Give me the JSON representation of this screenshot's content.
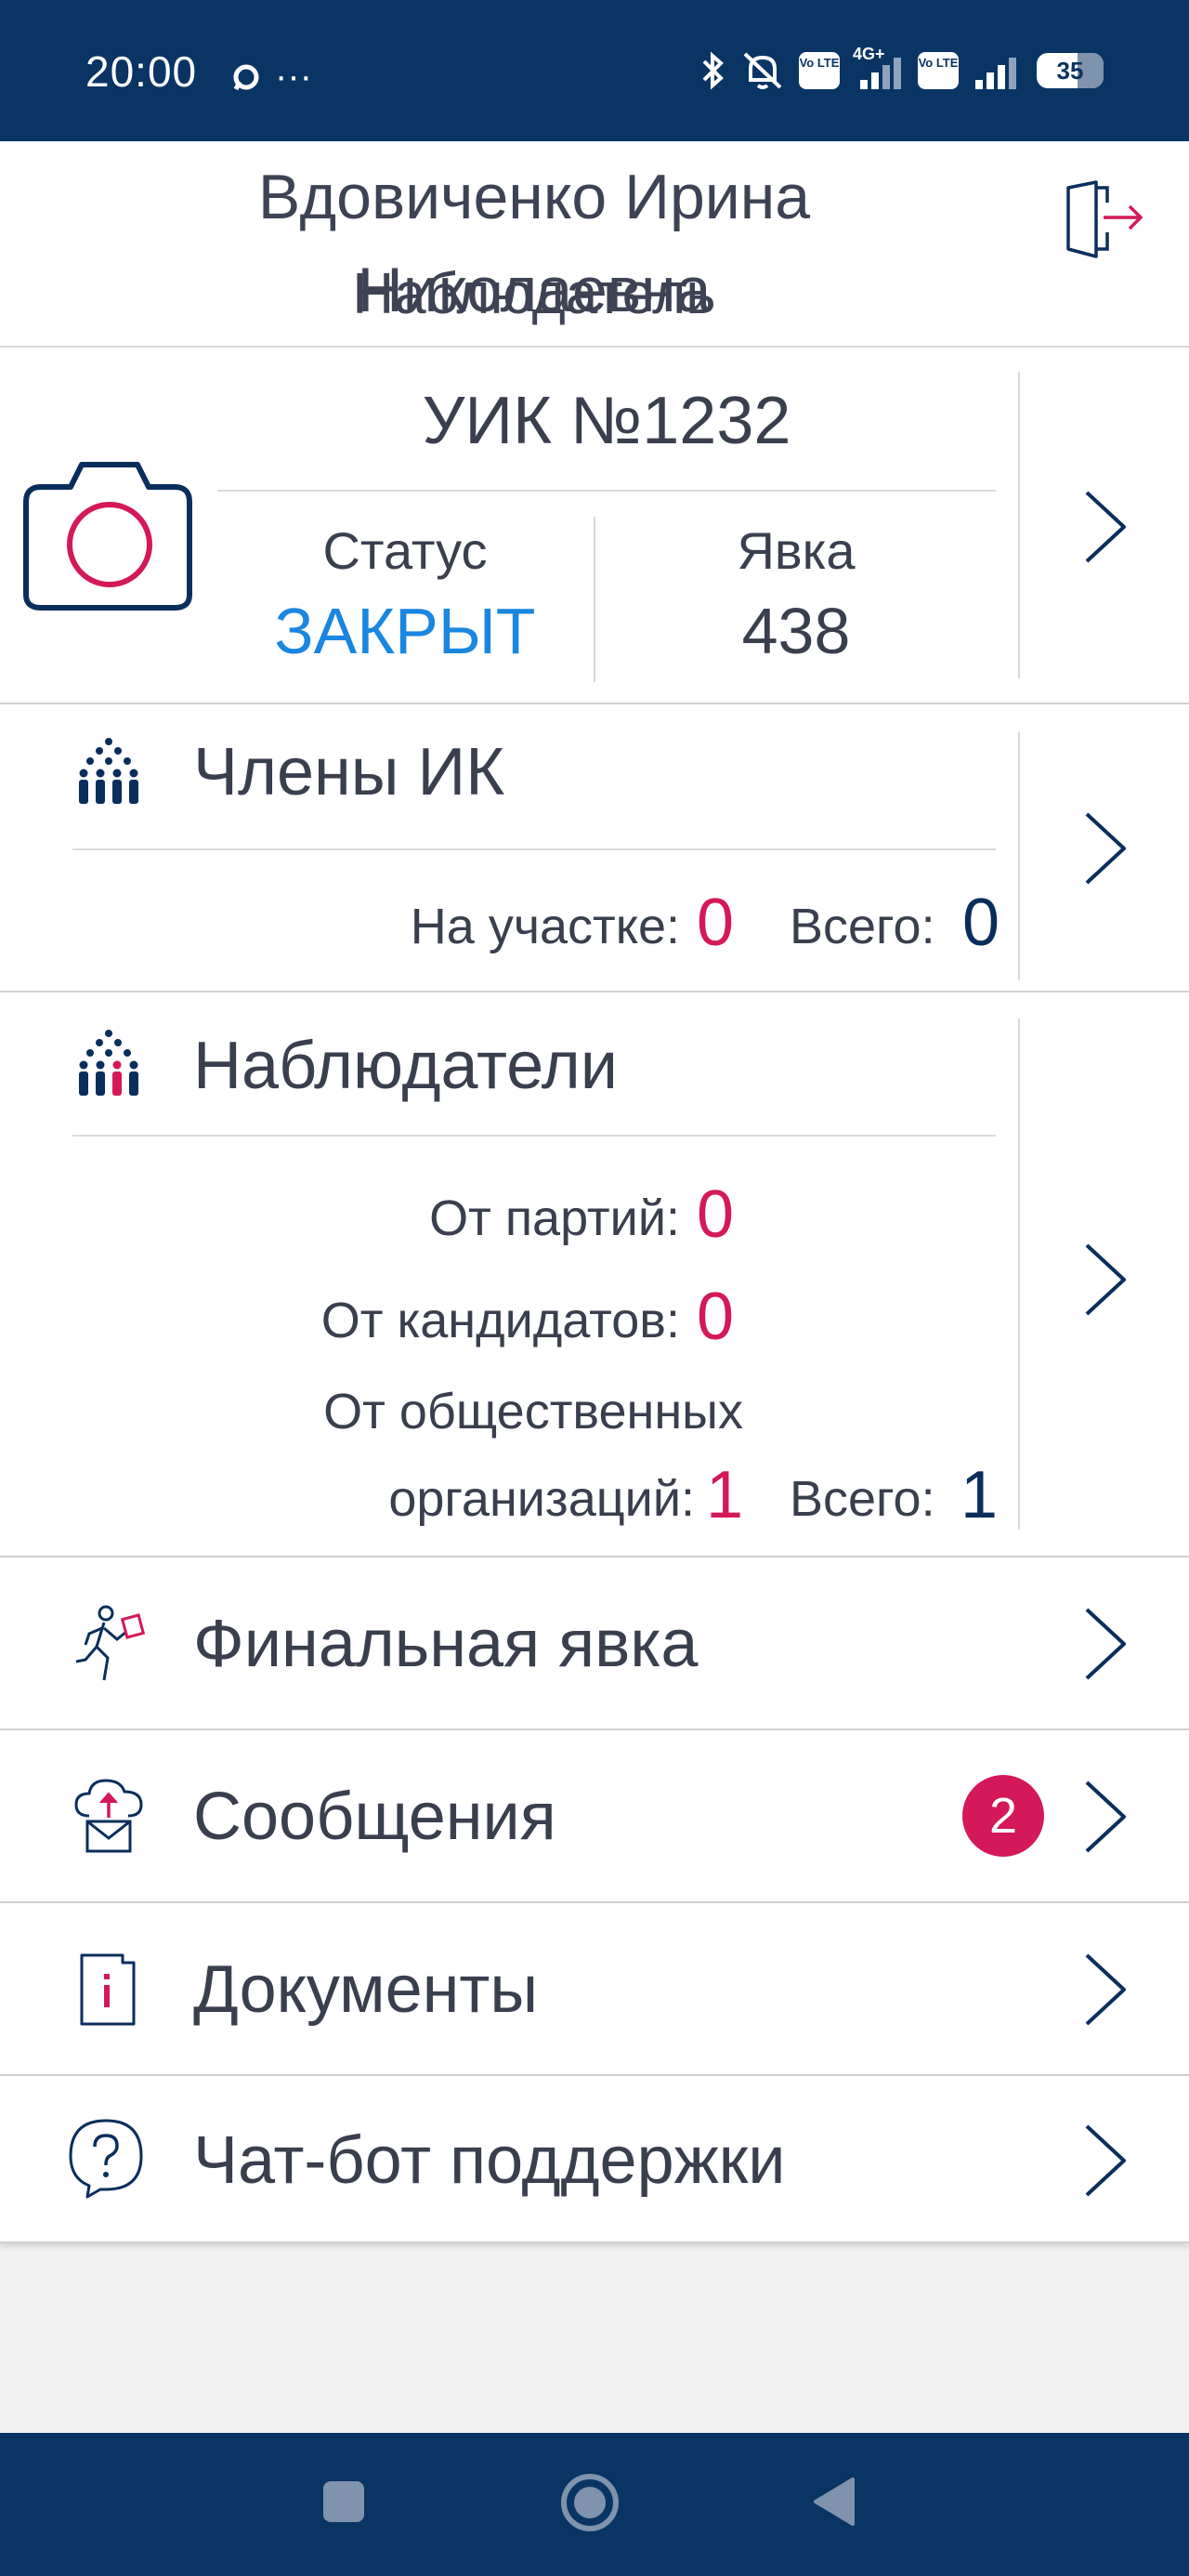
{
  "status_bar": {
    "time": "20:00",
    "dots": "···",
    "network": "4G+",
    "volte_1": "Vo LTE",
    "volte_2": "Vo LTE",
    "battery": "35"
  },
  "header": {
    "name": "Вдовиченко Ирина Николаевна",
    "role": "Наблюдатель"
  },
  "uik": {
    "title": "УИК №1232",
    "status_label": "Статус",
    "status_value": "ЗАКРЫТ",
    "turnout_label": "Явка",
    "turnout_value": "438"
  },
  "ik_members": {
    "title": "Члены ИК",
    "at_site_label": "На участке:",
    "at_site_value": "0",
    "total_label": "Всего:",
    "total_value": "0"
  },
  "observers": {
    "title": "Наблюдатели",
    "parties_label": "От партий:",
    "parties_value": "0",
    "candidates_label": "От кандидатов:",
    "candidates_value": "0",
    "orgs_label_line1": "От общественных",
    "orgs_label_line2": "организаций:",
    "orgs_value": "1",
    "total_label": "Всего:",
    "total_value": "1"
  },
  "menu": {
    "final_turnout": "Финальная явка",
    "messages": "Сообщения",
    "messages_badge": "2",
    "documents": "Документы",
    "chatbot": "Чат-бот поддержки"
  },
  "colors": {
    "navy": "#0a3463",
    "pink": "#d4185a",
    "blue": "#1a86e0"
  }
}
